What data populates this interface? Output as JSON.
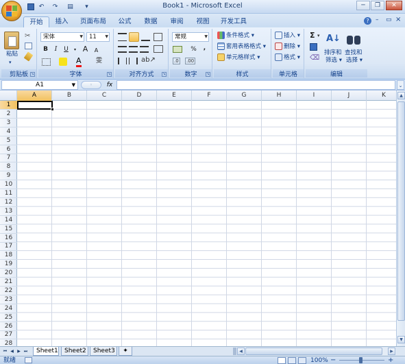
{
  "title": "Book1 - Microsoft Excel",
  "qat": {
    "undo_glyph": "↶",
    "redo_glyph": "↷",
    "print_glyph": "▤",
    "more_glyph": "▾"
  },
  "window_controls": {
    "minimize": "─",
    "restore": "❐",
    "close": "✕"
  },
  "tabs": [
    "开始",
    "插入",
    "页面布局",
    "公式",
    "数据",
    "审阅",
    "视图",
    "开发工具"
  ],
  "active_tab": "开始",
  "ribbon_right": {
    "help": "?",
    "min": "–",
    "restore": "▭",
    "close": "×"
  },
  "groups": {
    "clipboard": {
      "label": "剪贴板",
      "paste": "粘贴"
    },
    "font": {
      "label": "字体",
      "font_name": "宋体",
      "font_size": "11",
      "bold": "B",
      "italic": "I",
      "underline": "U",
      "grow": "A",
      "shrink": "A",
      "wen": "雯"
    },
    "alignment": {
      "label": "对齐方式"
    },
    "number": {
      "label": "数字",
      "format": "常规",
      "percent": "%",
      "comma": ","
    },
    "styles": {
      "label": "样式",
      "conditional": "条件格式",
      "table": "套用表格格式",
      "cell_styles": "单元格样式"
    },
    "cells": {
      "label": "单元格",
      "insert": "插入",
      "delete": "删除",
      "format": "格式"
    },
    "editing": {
      "label": "编辑",
      "sum": "Σ",
      "sort1": "排序和",
      "sort2": "筛选",
      "find1": "查找和",
      "find2": "选择"
    }
  },
  "formula_bar": {
    "name_box": "A1",
    "fx": "fx",
    "formula": ""
  },
  "columns": [
    "A",
    "B",
    "C",
    "D",
    "E",
    "F",
    "G",
    "H",
    "I",
    "J",
    "K"
  ],
  "rows": [
    "1",
    "2",
    "3",
    "4",
    "5",
    "6",
    "7",
    "8",
    "9",
    "10",
    "11",
    "12",
    "13",
    "14",
    "15",
    "16",
    "17",
    "18",
    "19",
    "20",
    "21",
    "22",
    "23",
    "24",
    "25",
    "26",
    "27",
    "28"
  ],
  "selected_cell": "A1",
  "sheets": [
    "Sheet1",
    "Sheet2",
    "Sheet3"
  ],
  "active_sheet": "Sheet1",
  "status": {
    "ready": "就绪",
    "zoom": "100%",
    "zoom_minus": "−",
    "zoom_plus": "+"
  },
  "colors": {
    "accent": "#15428b",
    "selected_header": "#f1c15f",
    "grid_line": "#d0d7e5"
  }
}
